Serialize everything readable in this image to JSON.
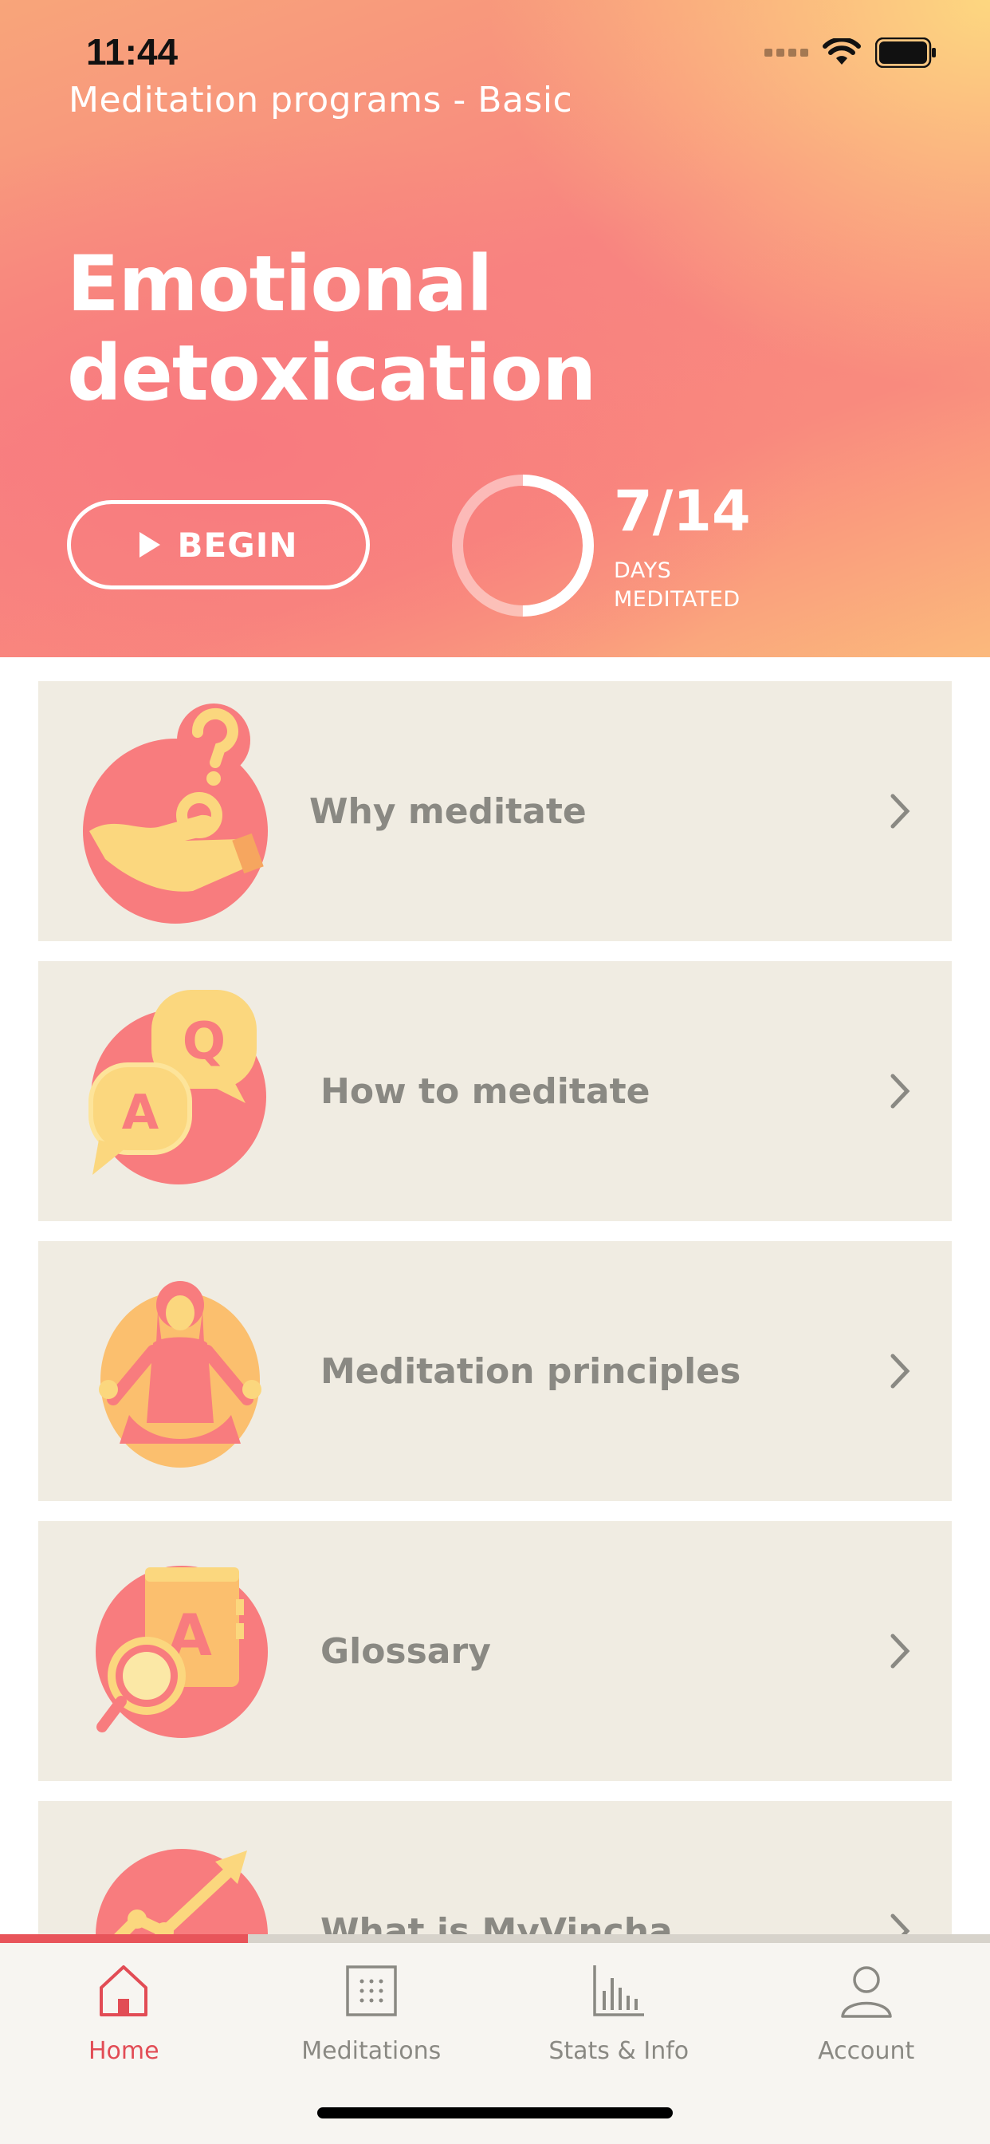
{
  "status_bar": {
    "time": "11:44"
  },
  "header": {
    "subtitle": "Meditation programs - Basic",
    "title": "Emotional detoxication",
    "begin_label": "BEGIN",
    "progress": {
      "value_text": "7/14",
      "completed": 7,
      "total": 14,
      "caption_line1": "DAYS",
      "caption_line2": "MEDITATED"
    }
  },
  "cards": [
    {
      "label": "Why meditate",
      "icon": "hand-question-icon"
    },
    {
      "label": "How to meditate",
      "icon": "qa-bubbles-icon"
    },
    {
      "label": "Meditation principles",
      "icon": "meditating-woman-icon"
    },
    {
      "label": "Glossary",
      "icon": "glossary-book-icon"
    },
    {
      "label": "What is MyVincha",
      "icon": "growth-chart-icon"
    }
  ],
  "tabbar": {
    "progress_fraction": 0.25,
    "tabs": [
      {
        "label": "Home",
        "icon": "home-icon",
        "active": true
      },
      {
        "label": "Meditations",
        "icon": "grid-icon",
        "active": false
      },
      {
        "label": "Stats & Info",
        "icon": "bar-chart-icon",
        "active": false
      },
      {
        "label": "Account",
        "icon": "person-icon",
        "active": false
      }
    ]
  },
  "colors": {
    "accent": "#e24c55",
    "card_bg": "#f0ece2",
    "header_coral": "#f87a7f",
    "header_yellow": "#fdd780"
  }
}
